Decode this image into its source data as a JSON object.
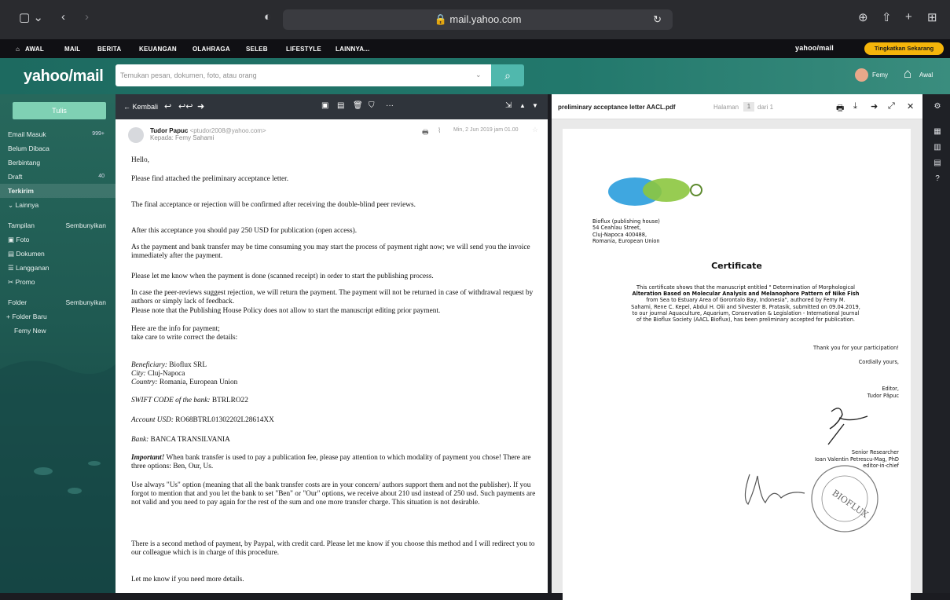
{
  "browser": {
    "url": "mail.yahoo.com"
  },
  "ynav": {
    "items": [
      "AWAL",
      "MAIL",
      "BERITA",
      "KEUANGAN",
      "OLAHRAGA",
      "SELEB",
      "LIFESTYLE",
      "LAINNYA..."
    ],
    "brand": "yahoo/mail",
    "upgrade": "Tingkatkan Sekarang"
  },
  "header": {
    "logo": "yahoo/mail",
    "search_placeholder": "Temukan pesan, dokumen, foto, atau orang",
    "user": "Femy",
    "home": "Awal"
  },
  "sidebar": {
    "compose": "Tulis",
    "inbox": "Email Masuk",
    "inbox_count": "999+",
    "unread": "Belum Dibaca",
    "starred": "Berbintang",
    "drafts": "Draft",
    "drafts_count": "40",
    "sent": "Terkirim",
    "more": "Lainnya",
    "views": "Tampilan",
    "views_toggle": "Sembunyikan",
    "photos": "Foto",
    "documents": "Dokumen",
    "subscriptions": "Langganan",
    "promo": "Promo",
    "folders": "Folder",
    "folders_toggle": "Sembunyikan",
    "new_folder": "+ Folder Baru",
    "custom_folder": "Femy New"
  },
  "mail": {
    "back": "Kembali",
    "sender_name": "Tudor Papuc",
    "sender_email": "<ptudor2008@yahoo.com>",
    "to": "Kepada: Femy Sahami",
    "date": "Min, 2 Jun 2019 jam 01.00",
    "body": [
      "Hello,",
      "Please find attached the preliminary acceptance letter.",
      "The final acceptance or rejection will be confirmed after receiving the double-blind peer reviews.",
      "After this acceptance you should pay 250 USD for publication (open access).",
      "As the payment and bank transfer may be time consuming you may start the process of payment right now; we will send you the invoice immediately after the payment.",
      "Please let me know when the payment is done (scanned receipt) in order to start the publishing process.",
      "In case the peer-reviews suggest rejection, we will return the payment. The payment will not be returned in case of withdrawal request by authors or simply lack of feedback.",
      "Please note that the Publishing House Policy does not allow to start the manuscript editing prior payment.",
      "Here are the info for payment;",
      "take care to write correct the details:",
      "Use always \"Us\" option (meaning that all the bank transfer costs are in your concern/ authors support them and not the publisher). If you forgot to mention that and you let the bank to set \"Ben\" or \"Our\" options, we receive about 210 usd instead of 250 usd. Such payments are not valid and you need to pay again for the rest of the sum and one more transfer charge. This situation is not desirable.",
      "There is a second method of payment, by Paypal, with credit card. Please let me know if you choose this method and I will redirect you to our colleague which is in charge of this procedure.",
      "Let me know if you need more details."
    ],
    "beneficiary_label": "Beneficiary:",
    "beneficiary": "Bioflux SRL",
    "city_label": "City:",
    "city": "Cluj-Napoca",
    "country_label": "Country:",
    "country": "Romania, European Union",
    "swift_label": "SWIFT CODE of the bank:",
    "swift": "BTRLRO22",
    "account_label": "Account USD:",
    "account": "RO68BTRL01302202L28614XX",
    "bank_label": "Bank:",
    "bank": "BANCA TRANSILVANIA",
    "important_label": "Important!",
    "important": "When bank transfer is used to pay a publication fee, please pay attention to which modality of payment you chose! There are three options: Ben, Our, Us."
  },
  "pdf": {
    "filename": "preliminary acceptance letter AACL.pdf",
    "page_label": "Halaman",
    "page": "1",
    "of": "dari 1",
    "address": [
      "Bioflux (publishing house)",
      "54 Ceahlau Street,",
      "Cluj-Napoca 400488,",
      "Romania, European Union"
    ],
    "title": "Certificate",
    "cert_lines": [
      "This certificate shows that the manuscript entitled \" Determination of Morphological",
      "Alteration Based on Molecular Analysis and Melanophore Pattern of Nike Fish",
      "from Sea to Estuary Area of Gorontalo Bay, Indonesia\", authored by Femy M.",
      "Sahami, Rene C. Kepel, Abdul H. Olii and Silvester B. Pratasik, submitted on 09.04.2019,",
      "to our journal Aquaculture, Aquarium, Conservation & Legislation - International Journal",
      "of the Bioflux Society (AACL Bioflux), has been preliminary accepted for publication."
    ],
    "thanks": "Thank you for your participation!",
    "closing": "Cordially yours,",
    "editor_role": "Editor,",
    "editor_name": "Tudor Păpuc",
    "chief_role": "Senior Researcher",
    "chief_name": "Ioan Valentin Petrescu-Mag, PhD",
    "chief_title": "editor-in-chief",
    "stamp": "BIOFLUX"
  },
  "colors": {
    "accent": "#1d6a60",
    "upgrade": "#f5b50a",
    "compose": "#7fd1b4"
  }
}
